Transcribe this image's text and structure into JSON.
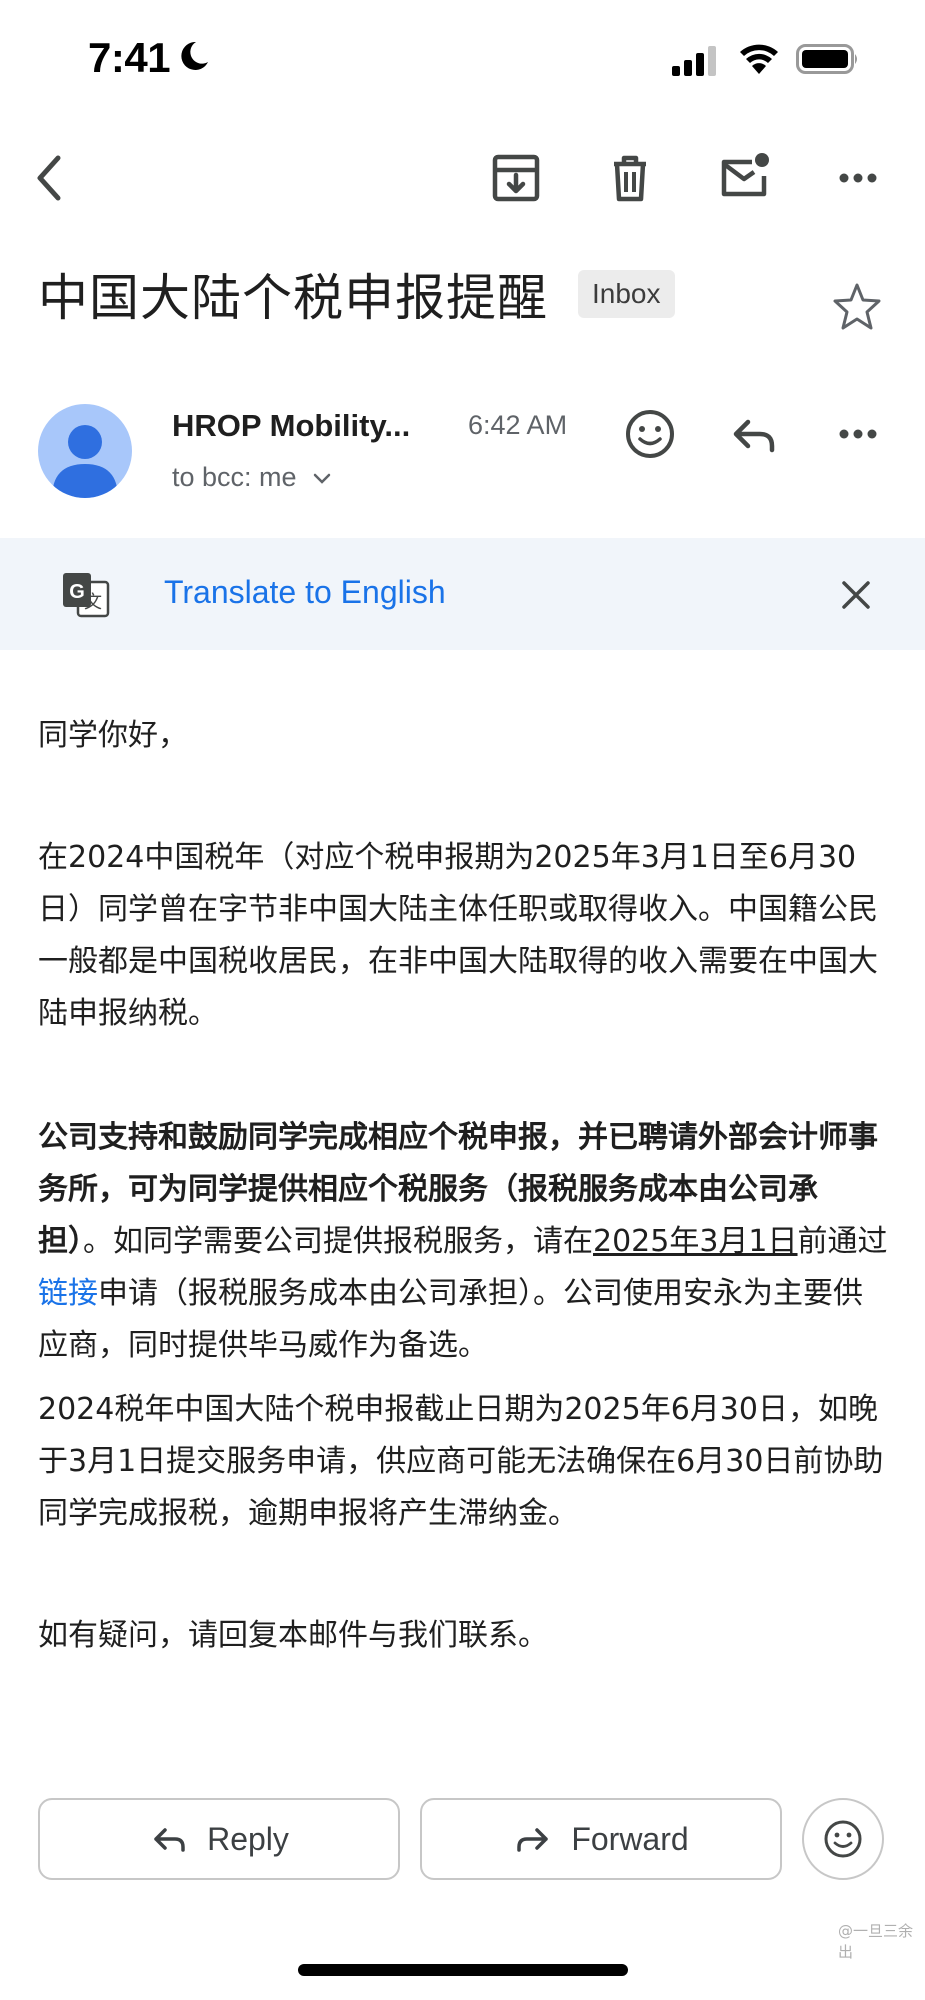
{
  "status_bar": {
    "time": "7:41"
  },
  "email": {
    "subject": "中国大陆个税申报提醒",
    "label": "Inbox",
    "sender": "HROP Mobility...",
    "time": "6:42 AM",
    "recipients": "to bcc: me"
  },
  "translate": {
    "label": "Translate to English"
  },
  "body": {
    "greeting": "同学你好，",
    "p1": "在2024中国税年（对应个税申报期为2025年3月1日至6月30日）同学曾在字节非中国大陆主体任职或取得收入。中国籍公民一般都是中国税收居民，在非中国大陆取得的收入需要在中国大陆申报纳税。",
    "p2_bold": "公司支持和鼓励同学完成相应个税申报，并已聘请外部会计师事务所，可为同学提供相应个税服务（报税服务成本由公司承担）",
    "p2_a": "。如同学需要公司提供报税服务，请在",
    "p2_date": "2025年3月1日",
    "p2_b": "前通过",
    "p2_link": "链接",
    "p2_c": "申请（报税服务成本由公司承担）。公司使用安永为主要供应商，同时提供毕马威作为备选。",
    "p3": "2024税年中国大陆个税申报截止日期为2025年6月30日，如晚于3月1日提交服务申请，供应商可能无法确保在6月30日前协助同学完成报税，逾期申报将产生滞纳金。",
    "p4": "如有疑问，请回复本邮件与我们联系。"
  },
  "actions": {
    "reply": "Reply",
    "forward": "Forward"
  },
  "watermark": "@一旦三余出"
}
